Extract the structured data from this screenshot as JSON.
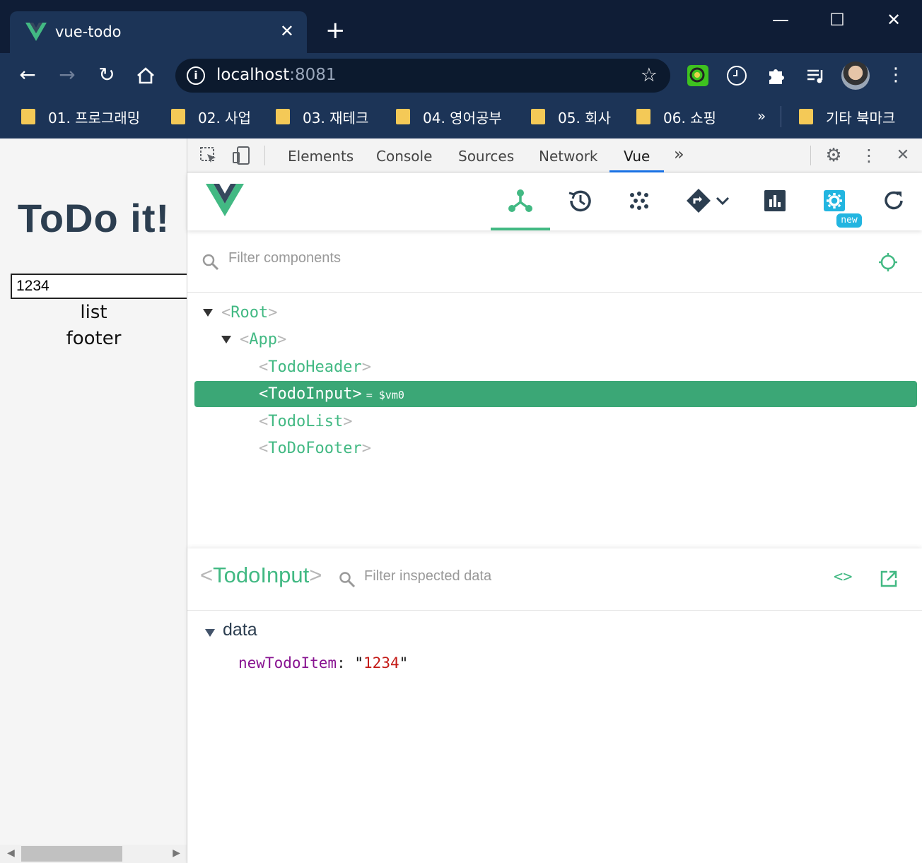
{
  "browser": {
    "tab_title": "vue-todo",
    "tab_close": "✕",
    "new_tab": "+",
    "window_controls": {
      "minimize": "—",
      "maximize": "☐",
      "close": "✕"
    },
    "url_host": "localhost",
    "url_port": ":8081",
    "bookmarks": [
      {
        "label": "01. 프로그래밍"
      },
      {
        "label": "02. 사업"
      },
      {
        "label": "03. 재테크"
      },
      {
        "label": "04. 영어공부"
      },
      {
        "label": "05. 회사"
      },
      {
        "label": "06. 쇼핑"
      }
    ],
    "bookmarks_more": "»",
    "other_bookmarks": "기타 북마크"
  },
  "page": {
    "title": "ToDo it!",
    "input_value": "1234",
    "list_text": "list",
    "footer_text": "footer"
  },
  "devtools": {
    "tabs": [
      "Elements",
      "Console",
      "Sources",
      "Network",
      "Vue"
    ],
    "active_tab": "Vue",
    "overflow": "»",
    "close": "✕"
  },
  "vue": {
    "new_badge": "new",
    "filter_placeholder": "Filter components",
    "tree": [
      {
        "name": "Root",
        "expanded": true,
        "level": 0
      },
      {
        "name": "App",
        "expanded": true,
        "level": 1
      },
      {
        "name": "TodoHeader",
        "level": 2
      },
      {
        "name": "TodoInput",
        "level": 2,
        "selected": true,
        "vm": "= $vm0"
      },
      {
        "name": "TodoList",
        "level": 2
      },
      {
        "name": "ToDoFooter",
        "level": 2
      }
    ],
    "inspector": {
      "component": "TodoInput",
      "filter_placeholder": "Filter inspected data",
      "code_icon": "<>",
      "section": "data",
      "prop_key": "newTodoItem",
      "prop_value": "1234"
    }
  },
  "colors": {
    "vue_green": "#42b983",
    "selected_row": "#3ba776",
    "chrome_dark": "#0f1d36",
    "chrome_toolbar": "#1c3457",
    "devtools_active": "#1a73e8"
  }
}
